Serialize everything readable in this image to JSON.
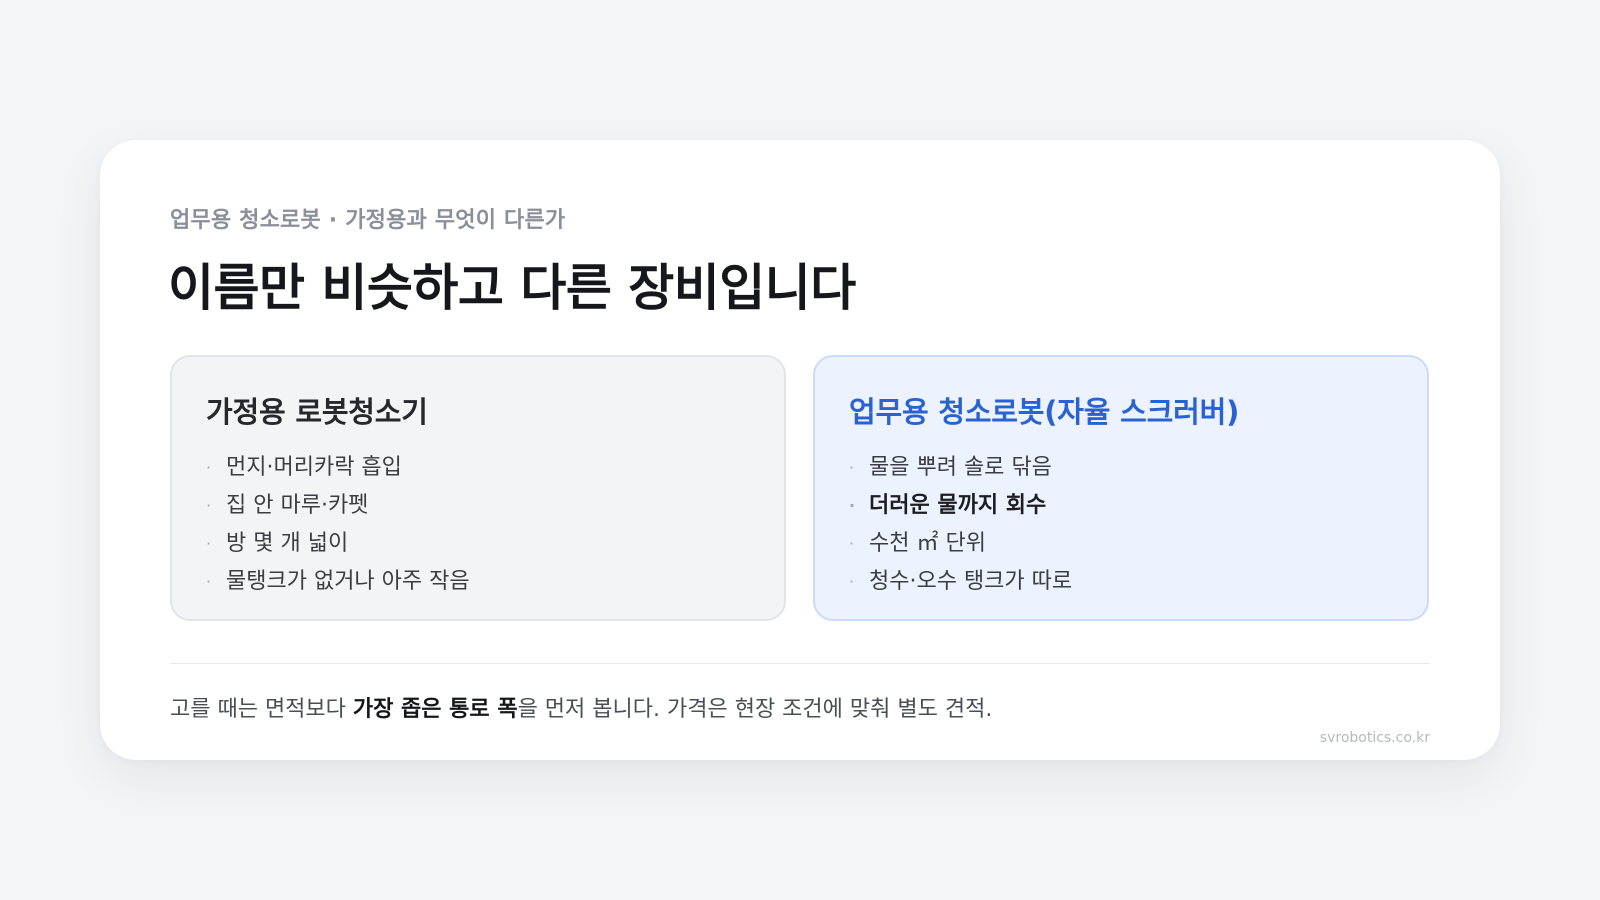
{
  "header": {
    "eyebrow": "업무용 청소로봇 · 가정용과 무엇이 다른가",
    "title": "이름만 비슷하고 다른 장비입니다"
  },
  "panels": {
    "home": {
      "title": "가정용 로봇청소기",
      "items": [
        "먼지·머리카락 흡입",
        "집 안 마루·카펫",
        "방 몇 개 넓이",
        "물탱크가 없거나 아주 작음"
      ]
    },
    "business": {
      "title": "업무용 청소로봇(자율 스크러버)",
      "items": [
        "물을 뿌려 솔로 닦음",
        "더러운 물까지 회수",
        "수천 ㎡ 단위",
        "청수·오수 탱크가 따로"
      ]
    }
  },
  "bullet_char": "·",
  "footer": {
    "note_before": "고를 때는 면적보다 ",
    "note_bold": "가장 좁은 통로 폭",
    "note_after": "을 먼저 봅니다. 가격은 현장 조건에 맞춰 별도 견적.",
    "site": "svrobotics.co.kr"
  },
  "colors": {
    "accent": "#2b62d1",
    "business_panel_bg": "#edf3fe",
    "home_panel_bg": "#f3f4f6"
  }
}
